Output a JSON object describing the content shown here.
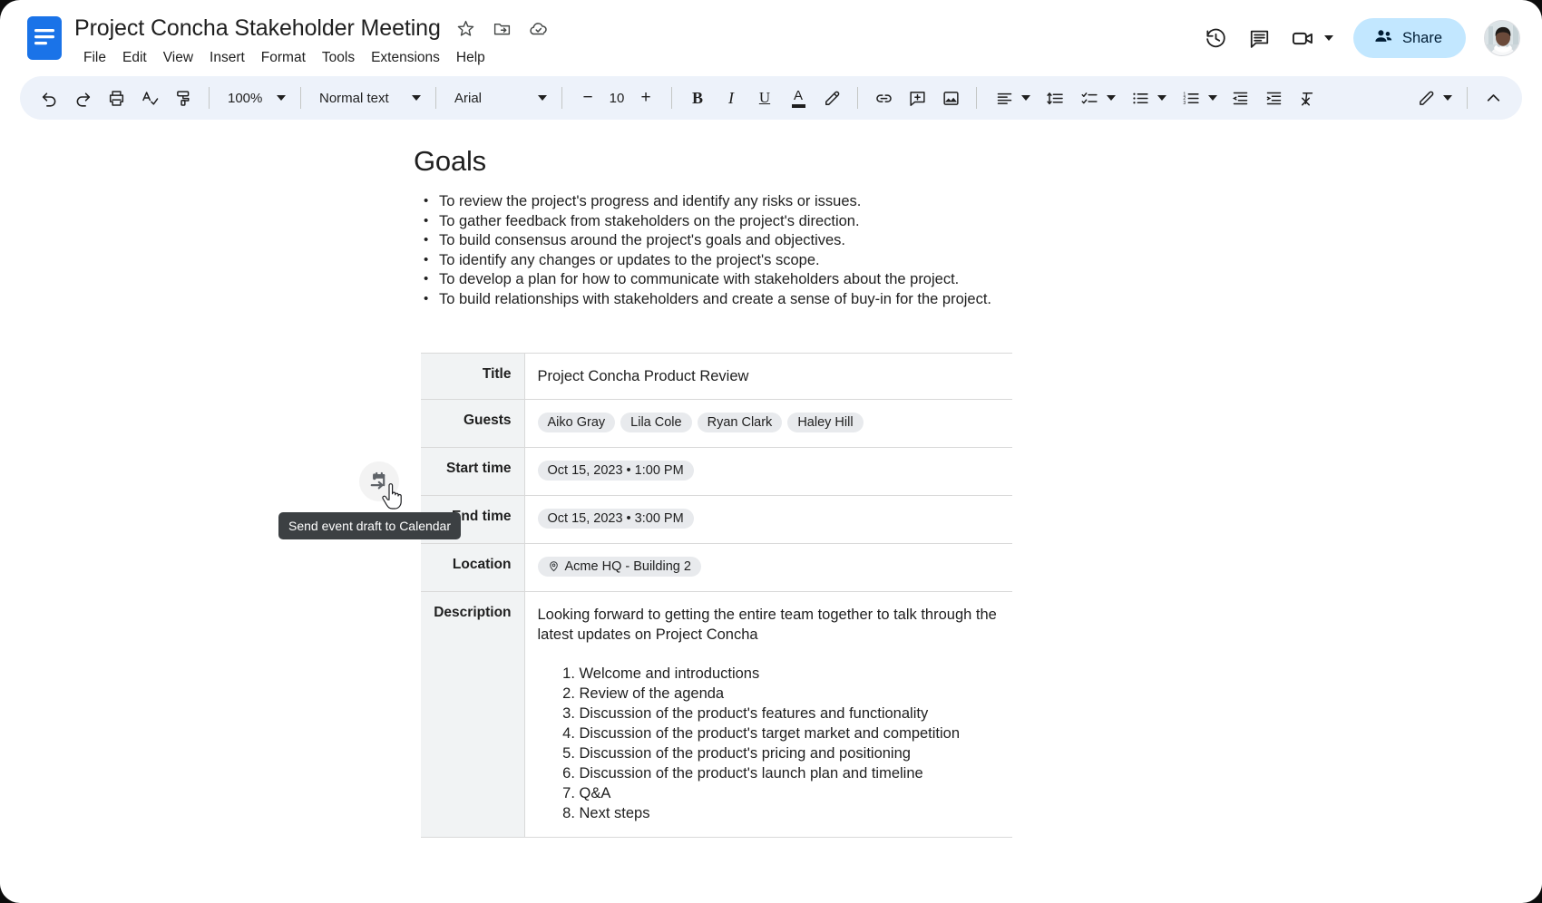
{
  "header": {
    "doc_title": "Project Concha Stakeholder Meeting",
    "title_icons": [
      {
        "name": "star-icon",
        "label": "Star"
      },
      {
        "name": "move-to-folder-icon",
        "label": "Move"
      },
      {
        "name": "cloud-saved-icon",
        "label": "Saved to Drive"
      }
    ],
    "menus": [
      "File",
      "Edit",
      "View",
      "Insert",
      "Format",
      "Tools",
      "Extensions",
      "Help"
    ],
    "right_icons": [
      {
        "name": "version-history-icon",
        "label": "Version history"
      },
      {
        "name": "comment-history-icon",
        "label": "Open comment history"
      },
      {
        "name": "meet-camera-icon",
        "label": "Join a call"
      }
    ],
    "share_label": "Share",
    "accent_share_bg": "#c2e7ff"
  },
  "toolbar": {
    "undo": "Undo",
    "redo": "Redo",
    "print": "Print",
    "spelling": "Spelling and grammar check",
    "paint_format": "Paint format",
    "zoom_value": "100%",
    "style_value": "Normal text",
    "font_value": "Arial",
    "font_size_decrease": "−",
    "font_size_value": "10",
    "font_size_increase": "+",
    "bold": "B",
    "italic": "I",
    "underline": "U",
    "text_color": "A",
    "highlight": "Highlight color",
    "insert_link": "Insert link",
    "add_comment": "Add comment",
    "insert_image": "Insert image",
    "align": "Align",
    "line_spacing": "Line & paragraph spacing",
    "checklist": "Checklist",
    "bulleted_list": "Bulleted list",
    "numbered_list": "Numbered list",
    "decrease_indent": "Decrease indent",
    "increase_indent": "Increase indent",
    "clear_formatting": "Clear formatting",
    "editing_mode": "Editing mode",
    "hide_menus": "Hide the menus"
  },
  "document": {
    "heading": "Goals",
    "bullets": [
      "To review the project's progress and identify any risks or issues.",
      "To gather feedback from stakeholders on the project's direction.",
      "To build consensus around the project's goals and objectives.",
      "To identify any changes or updates to the project's scope.",
      "To develop a plan for how to communicate with stakeholders about the project.",
      "To build relationships with stakeholders and create a sense of buy-in for the project."
    ],
    "event_table": {
      "rows": [
        {
          "label": "Title",
          "type": "text",
          "value": "Project Concha Product Review"
        },
        {
          "label": "Guests",
          "type": "chips",
          "chips": [
            "Aiko Gray",
            "Lila Cole",
            "Ryan Clark",
            "Haley Hill"
          ]
        },
        {
          "label": "Start time",
          "type": "chip",
          "value": "Oct 15, 2023 • 1:00 PM"
        },
        {
          "label": "End time",
          "type": "chip",
          "value": "Oct 15, 2023 • 3:00 PM"
        },
        {
          "label": "Location",
          "type": "chip-pin",
          "value": "Acme HQ - Building 2"
        },
        {
          "label": "Description",
          "type": "description"
        }
      ],
      "description_paragraph": "Looking forward to getting the entire team together to talk through the latest updates on Project Concha",
      "agenda": [
        "Welcome and introductions",
        "Review of the agenda",
        "Discussion of the product's features and functionality",
        "Discussion of the product's target market and competition",
        "Discussion of the product's pricing and positioning",
        "Discussion of the product's launch plan and timeline",
        "Q&A",
        "Next steps"
      ]
    }
  },
  "overlay": {
    "calendar_button_name": "send-event-draft-to-calendar",
    "tooltip_text": "Send event draft to Calendar",
    "tooltip_bg": "#3c4043"
  }
}
